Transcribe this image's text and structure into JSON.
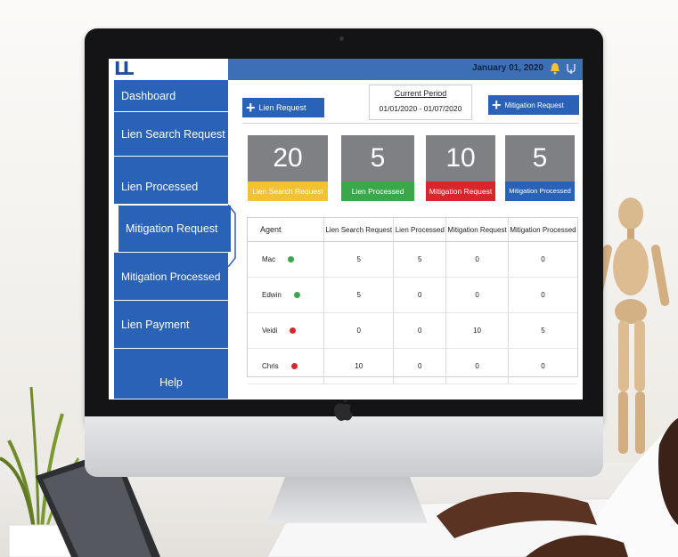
{
  "header": {
    "logo_text": "LL",
    "date": "January 01, 2020"
  },
  "sidebar": {
    "items": [
      {
        "label": "Dashboard"
      },
      {
        "label": "Lien Search Request"
      },
      {
        "label": "Lien  Processed"
      },
      {
        "label": "Mitigation Request"
      },
      {
        "label": "Mitigation Processed"
      },
      {
        "label": "Lien Payment"
      },
      {
        "label": "Help"
      }
    ],
    "active_index": 3
  },
  "toolbar": {
    "lien_request_label": "Lien Request",
    "mitigation_request_label": "Mitigation Request",
    "period_title": "Current Period",
    "period_range": "01/01/2020 - 01/07/2020"
  },
  "stats": [
    {
      "value": "20",
      "label": "Lien Search Request",
      "color": "#f2c233"
    },
    {
      "value": "5",
      "label": "Lien Processed",
      "color": "#3aa84a"
    },
    {
      "value": "10",
      "label": "Mitigation Request",
      "color": "#d9262c"
    },
    {
      "value": "5",
      "label": "Mitigation Processed",
      "color": "#2a62b8"
    }
  ],
  "table": {
    "headers": [
      "Agent",
      "Lien Search Request",
      "Lien Processed",
      "Mitigation Request",
      "Mitigation Processed"
    ],
    "rows": [
      {
        "agent": "Mac",
        "status": "green",
        "values": [
          "5",
          "5",
          "0",
          "0"
        ]
      },
      {
        "agent": "Edwin",
        "status": "green",
        "values": [
          "5",
          "0",
          "0",
          "0"
        ]
      },
      {
        "agent": "Veidi",
        "status": "red",
        "values": [
          "0",
          "0",
          "10",
          "5"
        ]
      },
      {
        "agent": "Chris",
        "status": "red",
        "values": [
          "10",
          "0",
          "0",
          "0"
        ]
      }
    ]
  },
  "colors": {
    "accent": "#2a62b8",
    "topbar": "#3c6fb6",
    "green": "#3aa84a",
    "red": "#d9262c"
  }
}
